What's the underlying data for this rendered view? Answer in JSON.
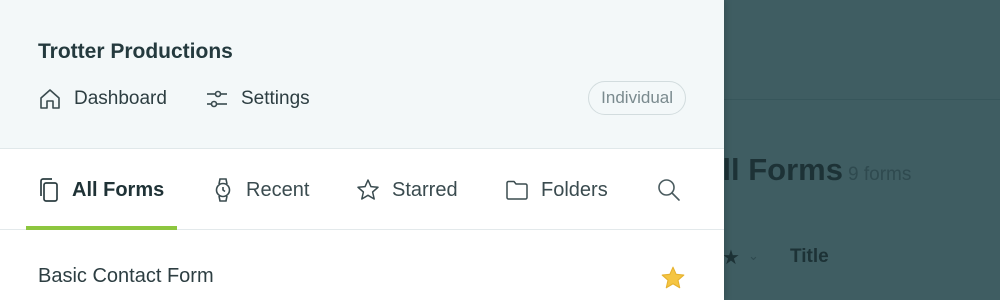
{
  "drawer": {
    "org_name": "Trotter Productions",
    "nav": {
      "dashboard": {
        "label": "Dashboard",
        "icon": "home-icon"
      },
      "settings": {
        "label": "Settings",
        "icon": "sliders-icon"
      }
    },
    "plan_badge": "Individual",
    "tabs": [
      {
        "label": "All Forms",
        "icon": "documents-icon",
        "active": true
      },
      {
        "label": "Recent",
        "icon": "watch-icon",
        "active": false
      },
      {
        "label": "Starred",
        "icon": "star-outline-icon",
        "active": false
      },
      {
        "label": "Folders",
        "icon": "folder-icon",
        "active": false
      }
    ],
    "search_icon": "search-icon",
    "forms": [
      {
        "name": "Basic Contact Form",
        "starred": true
      }
    ]
  },
  "background": {
    "title": "All Forms",
    "count": "9 forms",
    "column_title": "Title"
  },
  "colors": {
    "accent": "#8dc63f",
    "overlay": "#3f5d62",
    "star": "#f5c542"
  }
}
